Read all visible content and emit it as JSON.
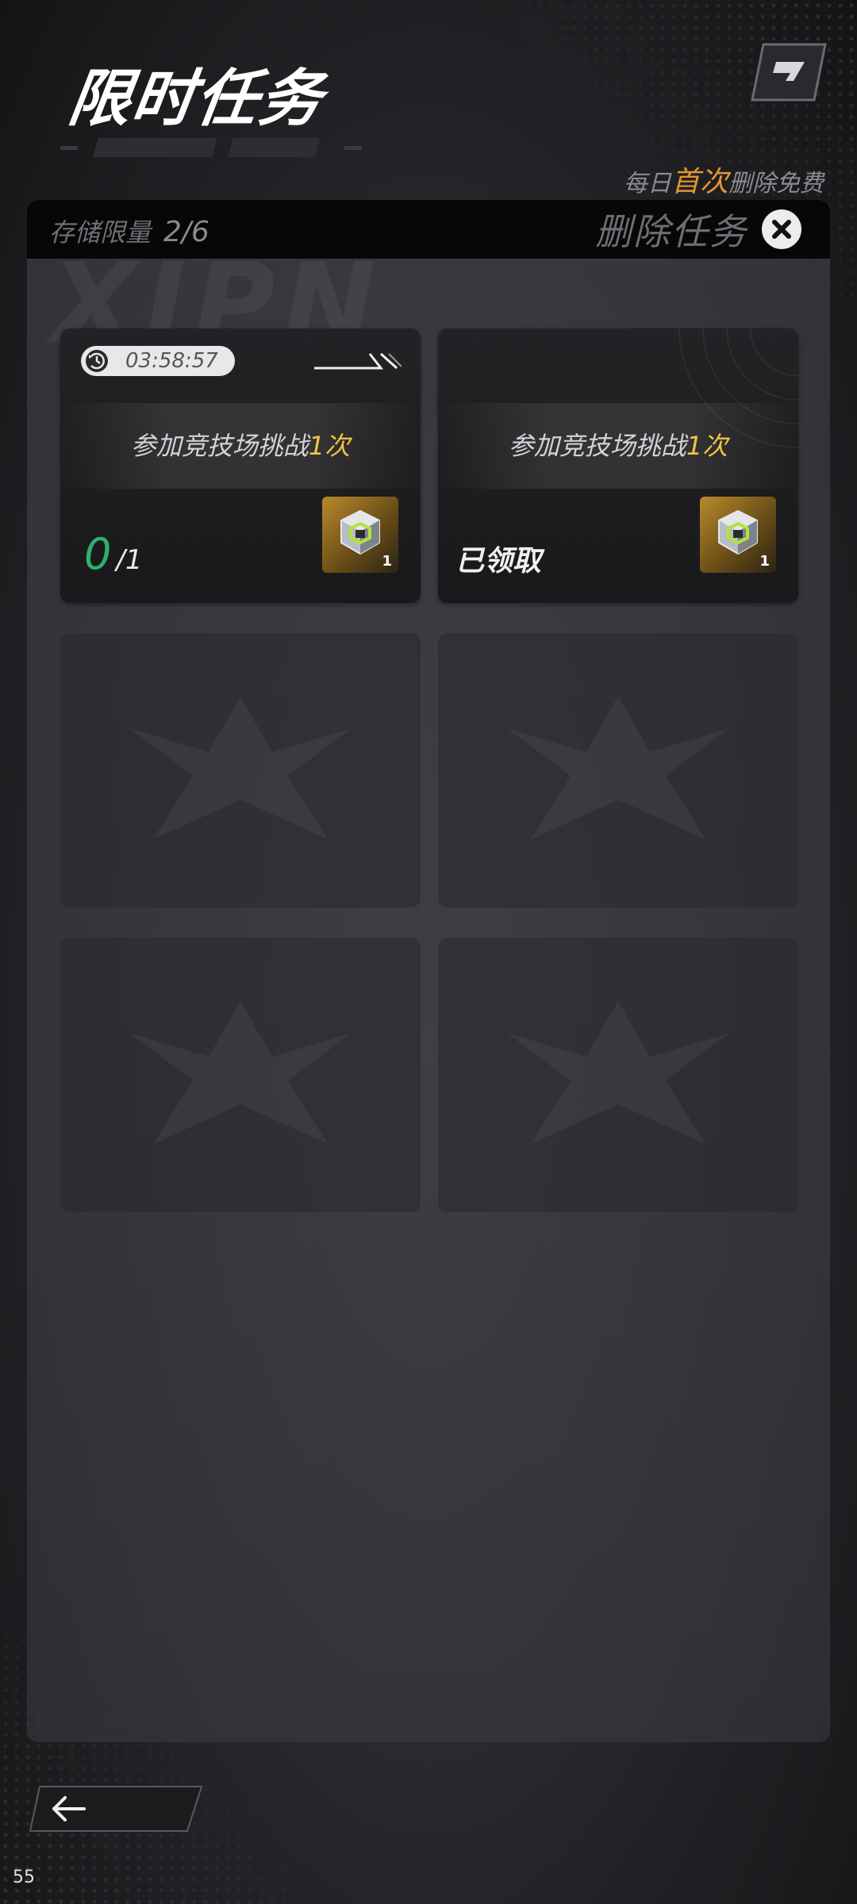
{
  "header": {
    "title": "限时任务",
    "daily_notice": {
      "prefix": "每日",
      "highlight": "首次",
      "suffix": "删除免费"
    }
  },
  "storage": {
    "label": "存储限量",
    "value": "2/6"
  },
  "delete_button": {
    "label": "删除任务"
  },
  "tasks": [
    {
      "timer": "03:58:57",
      "text": "参加竞技场挑战",
      "count": "1次",
      "progress_current": "0",
      "progress_total": "/1",
      "reward_count": "1",
      "status": ""
    },
    {
      "timer": "",
      "text": "参加竞技场挑战",
      "count": "1次",
      "progress_current": "",
      "progress_total": "",
      "reward_count": "1",
      "status": "已领取"
    }
  ],
  "empty_slots": 4,
  "page_number": "55",
  "colors": {
    "accent_gold": "#e2962e",
    "count_yellow": "#f2c541",
    "progress_green": "#2bb36e"
  },
  "icons": [
    "corner-menu-icon",
    "close-circle-icon",
    "timer-icon",
    "arrow-deco-icon",
    "cube-reward-icon",
    "back-arrow-icon",
    "empty-slot-emblem-icon"
  ]
}
